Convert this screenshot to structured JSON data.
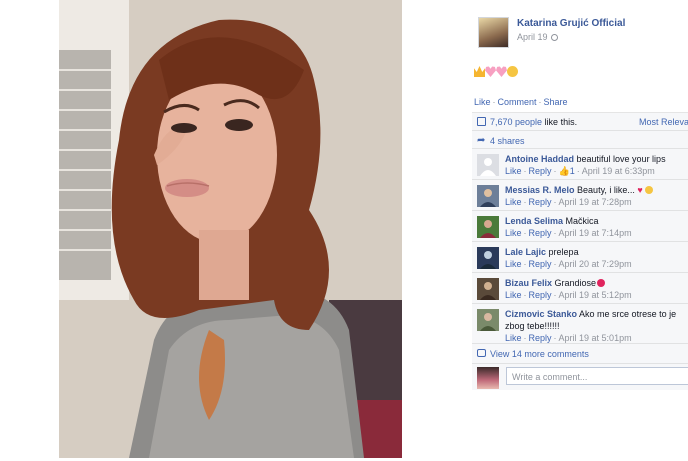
{
  "post": {
    "page_name": "Katarina Grujić Official",
    "date": "April 19",
    "emojis": [
      "crown-emoji",
      "pink-heart-emoji",
      "pink-heart-emoji",
      "smile-emoji"
    ]
  },
  "actions": {
    "like": "Like",
    "comment": "Comment",
    "share": "Share",
    "sep": "·"
  },
  "likes": {
    "count": "7,670 people",
    "rest": " like this.",
    "sort": "Most Relevant"
  },
  "shares": {
    "label": "4 shares"
  },
  "comments": [
    {
      "author": "Antoine Haddad",
      "text": "beautiful love your lips",
      "like": "Like",
      "reply": "Reply",
      "likes": "1",
      "time": "April 19 at 6:33pm"
    },
    {
      "author": "Messias R. Melo",
      "text": "Beauty, i like...",
      "like": "Like",
      "reply": "Reply",
      "time": "April 19 at 7:28pm"
    },
    {
      "author": "Lenda Selima",
      "text": "Mačkica",
      "like": "Like",
      "reply": "Reply",
      "time": "April 19 at 7:14pm"
    },
    {
      "author": "Lale Lajic",
      "text": "prelepa",
      "like": "Like",
      "reply": "Reply",
      "time": "April 20 at 7:29pm"
    },
    {
      "author": "Bizau Felix",
      "text": "Grandiose",
      "like": "Like",
      "reply": "Reply",
      "time": "April 19 at 5:12pm"
    },
    {
      "author": "Cizmovic Stanko",
      "text": "Ako me srce otrese to je zbog tebe!!!!!!",
      "like": "Like",
      "reply": "Reply",
      "time": "April 19 at 5:01pm"
    }
  ],
  "view_more": "View 14 more comments",
  "composer": {
    "placeholder": "Write a comment..."
  },
  "colors": {
    "link": "#3b5998",
    "action": "#4267b2",
    "muted": "#90949c",
    "panel_bg": "#f6f7f9",
    "heart": "#f25268"
  }
}
